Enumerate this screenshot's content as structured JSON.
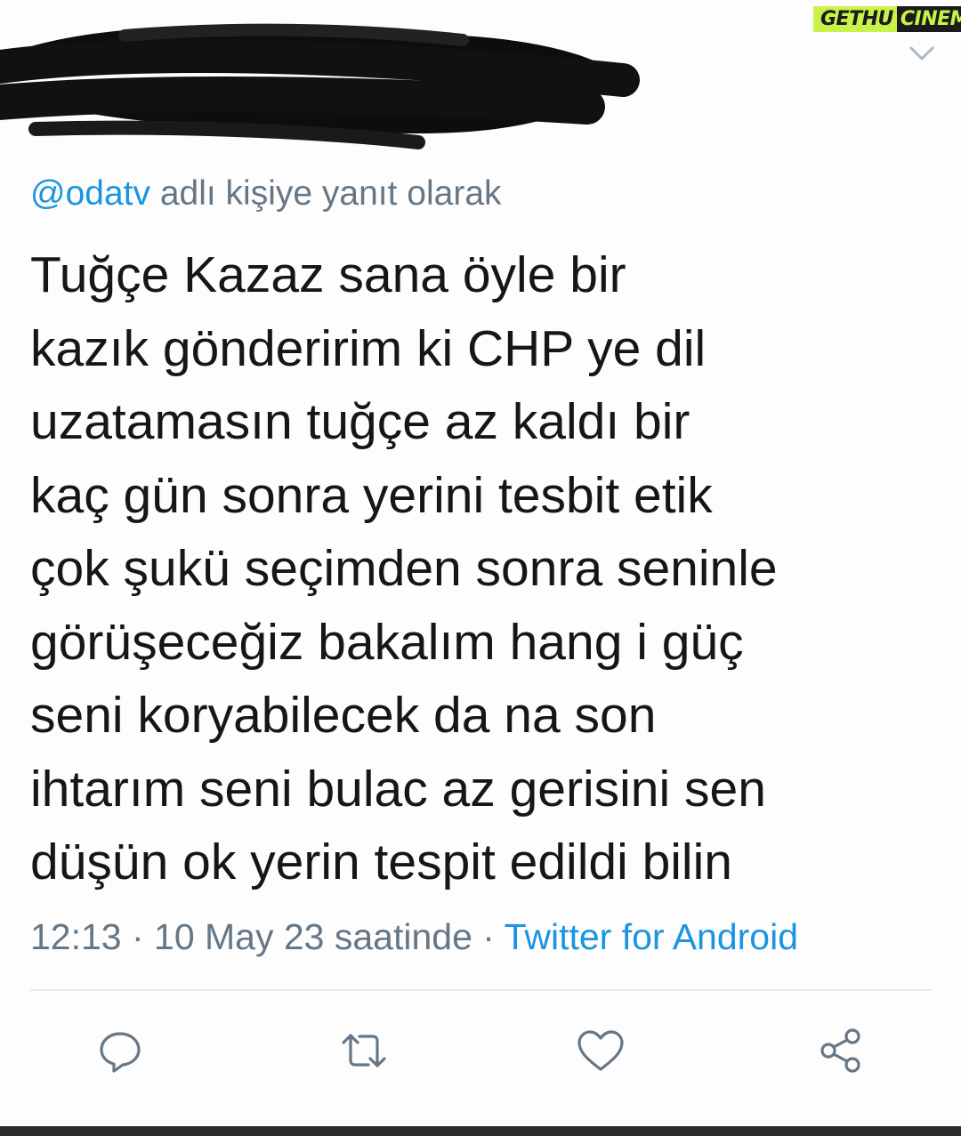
{
  "watermark": {
    "part1": "GETHU",
    "part2": "CINEMA"
  },
  "reply": {
    "handle": "@odatv",
    "suffix": " adlı kişiye yanıt olarak"
  },
  "tweet": {
    "lines": [
      "Tuğçe Kazaz sana öyle bir",
      "kazık gönderirim ki CHP ye dil",
      "uzatamasın tuğçe az kaldı bir",
      "kaç gün sonra yerini tesbit etik",
      "çok şukü seçimden sonra seninle",
      "görüşeceğiz bakalım hang i güç",
      "seni koryabilecek da na son",
      "ihtarım seni bulac az gerisini sen",
      "düşün ok yerin tespit edildi bilin"
    ]
  },
  "meta": {
    "time_date": "12:13 · 10 May 23 saatinde · ",
    "source": "Twitter for Android"
  },
  "actions": {
    "icons": [
      "reply-icon",
      "retweet-icon",
      "like-icon",
      "share-icon"
    ]
  },
  "colors": {
    "link_blue": "#1b95e0",
    "secondary_gray": "#657786",
    "text_dark": "#14171a",
    "icon_gray": "#657786"
  }
}
